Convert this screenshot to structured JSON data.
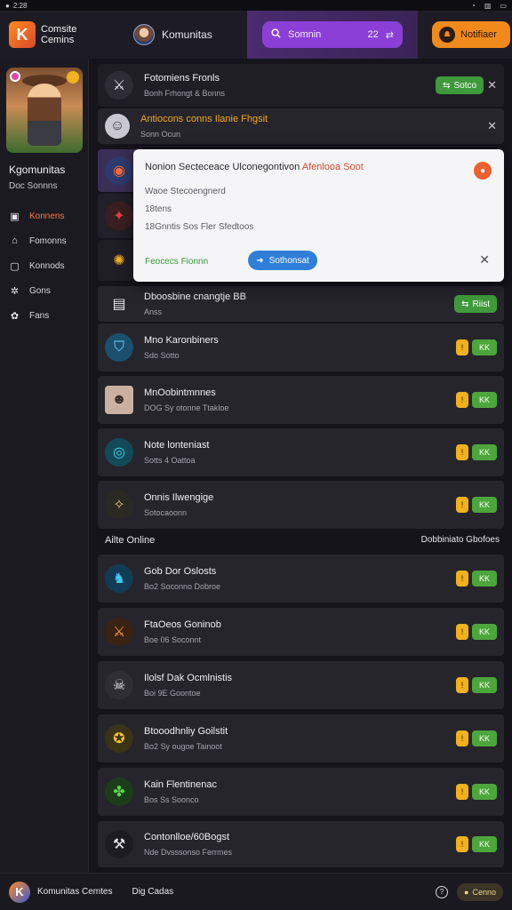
{
  "statusbar": {
    "time": "2:28",
    "icons": [
      "wifi-icon",
      "signal-icon",
      "battery-icon"
    ]
  },
  "topbar": {
    "brand_line1": "Comsite",
    "brand_line2": "Cemins",
    "user_name": "Komunitas",
    "search_text": "Somnin",
    "search_count": "22",
    "notif_label": "Notifiaer"
  },
  "sidebar": {
    "title": "Kgomunitas",
    "subtitle": "Doc Sonnns",
    "items": [
      {
        "label": "Konnens",
        "icon": "square-icon",
        "active": true
      },
      {
        "label": "Fomonns",
        "icon": "home-icon",
        "active": false
      },
      {
        "label": "Konnods",
        "icon": "chat-icon",
        "active": false
      },
      {
        "label": "Gons",
        "icon": "gear-icon",
        "active": false
      },
      {
        "label": "Fans",
        "icon": "settings-icon",
        "active": false
      }
    ]
  },
  "top_rows": [
    {
      "title": "Fotomiens Fronls",
      "sub": "Bonh Frhongt & Bonns",
      "action": "join",
      "action_label": "Sotco"
    },
    {
      "title": "Antiocons conns Ilanie Fhgsit",
      "sub": "Sonn Ocun",
      "action": "close"
    },
    {
      "title": "",
      "sub": "",
      "action": "none"
    },
    {
      "title": "",
      "sub": "",
      "action": "none"
    },
    {
      "title": "",
      "sub": "",
      "action": "none"
    },
    {
      "title": "Dboosbine cnangtje BB",
      "sub": "Anss",
      "action": "join",
      "action_label": "Riist"
    }
  ],
  "popup": {
    "title": "Nonion Secteceace Ulconegontivon",
    "title_highlight": "Afenlooa Soot",
    "line1": "Waoe Stecoengnerd",
    "line2": "18tens",
    "line3": "18Gnntis Sos Fler Sfedtoos",
    "status": "Feocecs Fionnn",
    "button_label": "Sothonsat"
  },
  "list_rows": [
    {
      "title": "Mno Karonbiners",
      "sub": "Sdo Sotto",
      "badge": "KK"
    },
    {
      "title": "MnOobintmnnes",
      "sub": "DOG Sy otonne Ttakloe",
      "badge": "KK"
    },
    {
      "title": "Note lonteniast",
      "sub": "Sotts 4 Oattoa",
      "badge": "KK"
    },
    {
      "title": "Onnis Ilwengige",
      "sub": "Sotocaoonn",
      "badge": "KK"
    }
  ],
  "section": {
    "left": "Ailte Online",
    "right": "Dobbiniato Gbofoes"
  },
  "online_rows": [
    {
      "title": "Gob Dor Oslosts",
      "sub": "Bo2 Soconno Dobroe",
      "badge": "KK"
    },
    {
      "title": "FtaOeos Goninob",
      "sub": "Boe 06 Soconnt",
      "badge": "KK"
    },
    {
      "title": "Ilolsf Dak Ocmlnistis",
      "sub": "Boi 9E Goontoe",
      "badge": "KK"
    },
    {
      "title": "Btooodhnliy Goilstit",
      "sub": "Bo2 Sy ougoe Tainoot",
      "badge": "KK"
    },
    {
      "title": "Kain Flentinenac",
      "sub": "Bos Ss Soonco",
      "badge": "KK"
    },
    {
      "title": "Contonlloe/60Bogst",
      "sub": "Nde Dvsssonso Ferrmes",
      "badge": "KK"
    }
  ],
  "bottombar": {
    "name": "Komunitas Cemtes",
    "mid": "Dig Cadas",
    "button_label": "Cenno"
  },
  "colors": {
    "accent_orange": "#f08a1a",
    "accent_purple": "#8b3fd6",
    "online_green": "#4ca63b",
    "badge_yellow": "#f2b11c"
  }
}
